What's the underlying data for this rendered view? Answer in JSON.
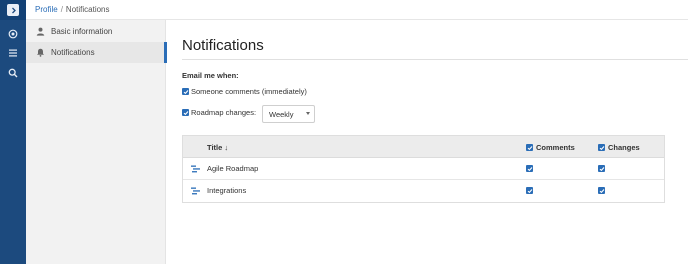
{
  "breadcrumb": {
    "parent": "Profile",
    "separator": "/",
    "current": "Notifications"
  },
  "sidenav": {
    "items": [
      {
        "label": "Basic information",
        "icon": "user-icon",
        "active": false
      },
      {
        "label": "Notifications",
        "icon": "bell-icon",
        "active": true
      }
    ]
  },
  "rail": {
    "icons": [
      "expand-icon",
      "target-icon",
      "list-icon",
      "search-icon"
    ]
  },
  "main": {
    "title": "Notifications",
    "email_label": "Email me when:",
    "options": [
      {
        "label": "Someone comments (immediately)",
        "checked": true
      },
      {
        "label": "Roadmap changes:",
        "checked": true
      }
    ],
    "frequency_select": {
      "value": "Weekly"
    }
  },
  "table": {
    "headers": {
      "title": "Title ↓",
      "comments": "Comments",
      "changes": "Changes"
    },
    "rows": [
      {
        "title": "Agile Roadmap",
        "comments": true,
        "changes": true,
        "icon": "roadmap-icon"
      },
      {
        "title": "Integrations",
        "comments": true,
        "changes": true,
        "icon": "roadmap-icon"
      }
    ]
  },
  "colors": {
    "accent": "#2a6db7",
    "rail": "#1c4a7e",
    "sidenav_bg": "#f2f2f2"
  }
}
